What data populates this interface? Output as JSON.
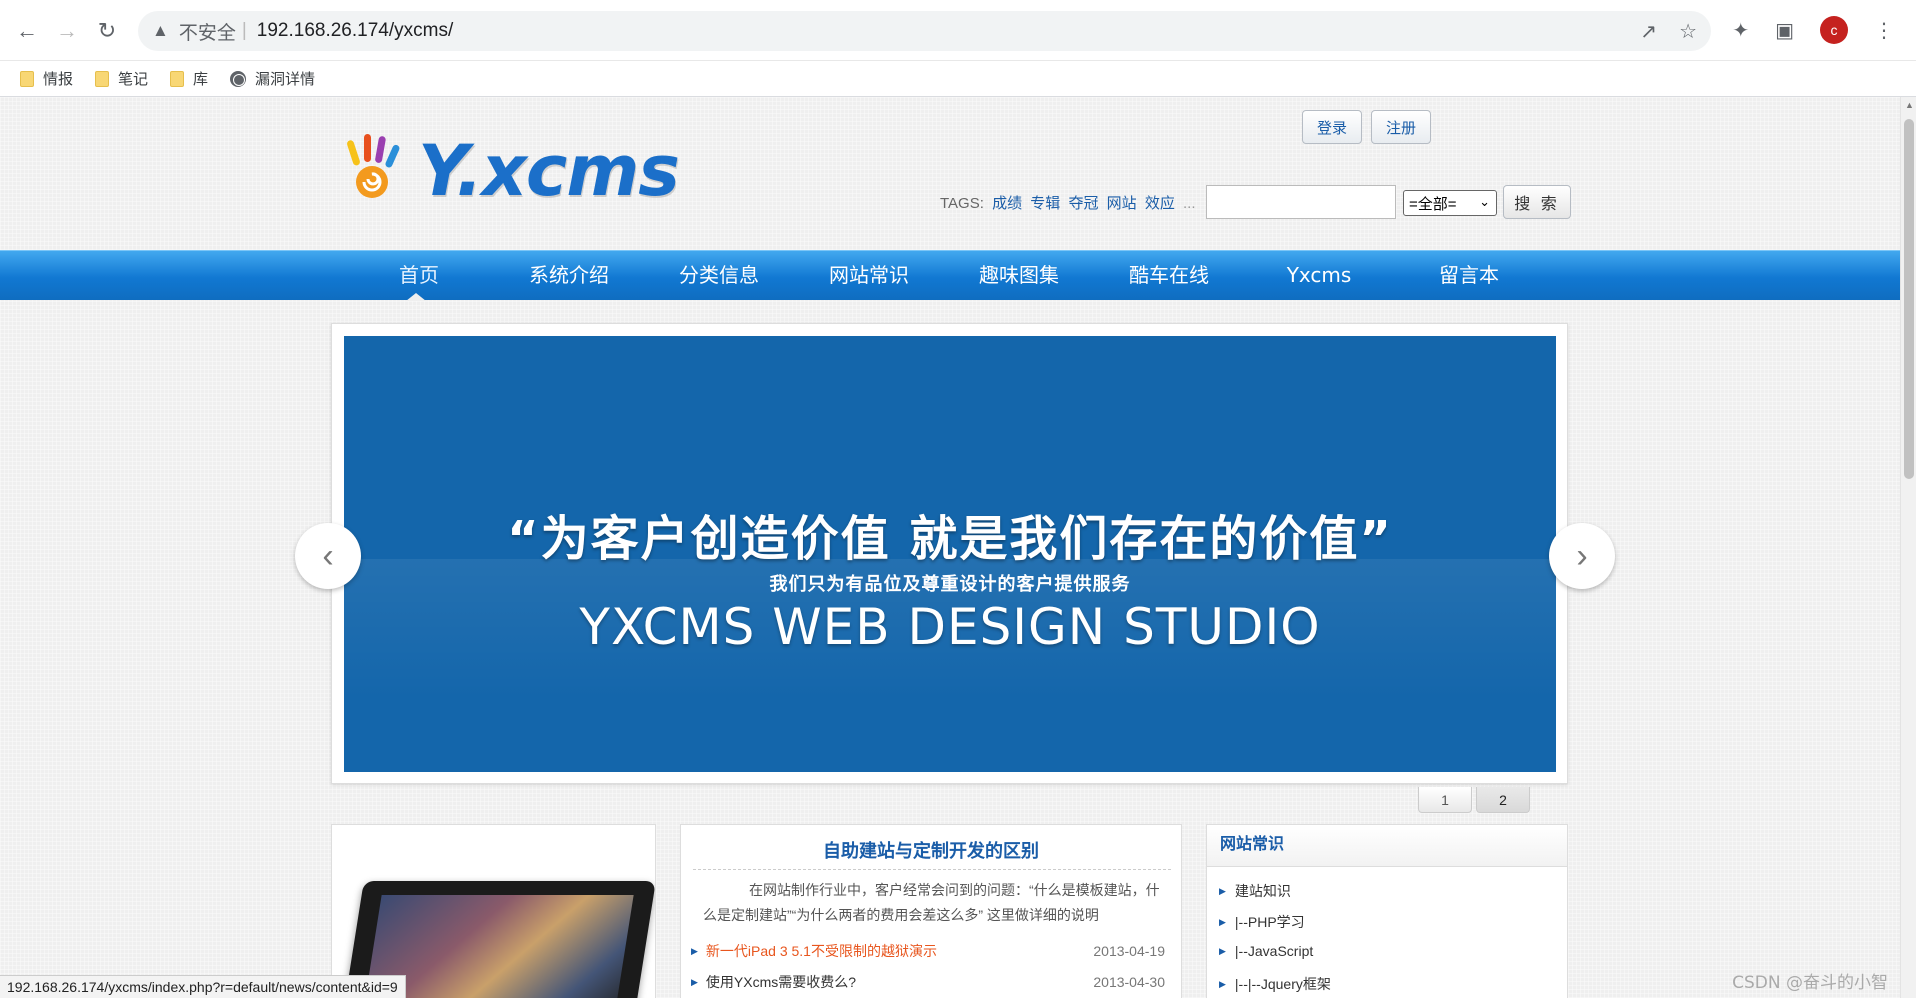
{
  "browser": {
    "insecure_label": "不安全",
    "url": "192.168.26.174/yxcms/",
    "avatar_letter": "c",
    "bookmarks": [
      {
        "label": "情报",
        "icon": "folder-icon"
      },
      {
        "label": "笔记",
        "icon": "folder-icon"
      },
      {
        "label": "库",
        "icon": "folder-icon"
      },
      {
        "label": "漏洞详情",
        "icon": "globe-icon"
      }
    ],
    "status_url": "192.168.26.174/yxcms/index.php?r=default/news/content&id=9"
  },
  "site": {
    "logo_text": "Y.xcms",
    "login_label": "登录",
    "register_label": "注册",
    "tags_label": "TAGS:",
    "tags": [
      "成绩",
      "专辑",
      "夺冠",
      "网站",
      "效应",
      "..."
    ],
    "search": {
      "select_value": "=全部=",
      "button_label": "搜 索",
      "placeholder": ""
    },
    "nav": [
      {
        "label": "首页",
        "active": true
      },
      {
        "label": "系统介绍"
      },
      {
        "label": "分类信息"
      },
      {
        "label": "网站常识"
      },
      {
        "label": "趣味图集"
      },
      {
        "label": "酷车在线"
      },
      {
        "label": "Yxcms"
      },
      {
        "label": "留言本"
      }
    ],
    "slider": {
      "headline": "“为客户创造价值  就是我们存在的价值”",
      "subline": "我们只为有品位及尊重设计的客户提供服务",
      "studio": "YXCMS WEB DESIGN STUDIO",
      "pages": [
        "1",
        "2"
      ],
      "active_page": "2",
      "bg_color": "#1466ab"
    },
    "featured": {
      "title": "自助建站与定制开发的区别",
      "summary": "在网站制作行业中，客户经常会问到的问题：“什么是模板建站，什么是定制建站”“为什么两者的费用会差这么多” 这里做详细的说明",
      "items": [
        {
          "text": "新一代iPad 3 5.1不受限制的越狱演示",
          "date": "2013-04-19",
          "hot": true
        },
        {
          "text": "使用YXcms需要收费么?",
          "date": "2013-04-30",
          "hot": false
        }
      ]
    },
    "sidebar": {
      "title": "网站常识",
      "items": [
        "建站知识",
        "|--PHP学习",
        "|--JavaScript",
        "|--|--Jquery框架"
      ]
    }
  },
  "watermark": "CSDN @奋斗的小智",
  "colors": {
    "accent": "#1a5da8",
    "nav": "#1178d2",
    "hot": "#e8561e"
  }
}
